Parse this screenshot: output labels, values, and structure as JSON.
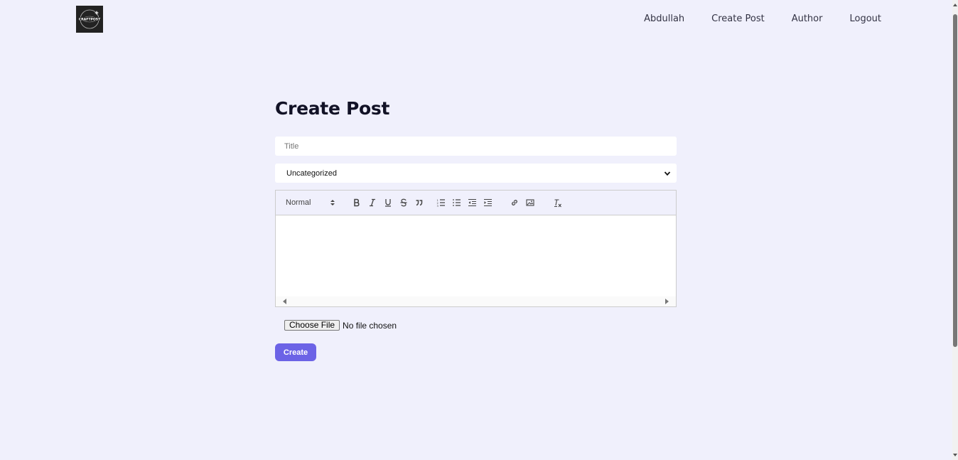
{
  "nav": {
    "logo_text": "CRAFTPOST",
    "links": [
      "Abdullah",
      "Create Post",
      "Author",
      "Logout"
    ]
  },
  "form": {
    "heading": "Create Post",
    "title_placeholder": "Title",
    "category_selected": "Uncategorized",
    "editor": {
      "header_format": "Normal",
      "tools": [
        "bold-icon",
        "italic-icon",
        "underline-icon",
        "strike-icon",
        "blockquote-icon",
        "ordered-list-icon",
        "bullet-list-icon",
        "outdent-icon",
        "indent-icon",
        "link-icon",
        "image-icon",
        "clean-format-icon"
      ]
    },
    "file_button": "Choose File",
    "file_status": "No file chosen",
    "submit_label": "Create"
  },
  "colors": {
    "page_bg": "#f0f0fc",
    "accent": "#6c63e6",
    "heading": "#121226"
  }
}
